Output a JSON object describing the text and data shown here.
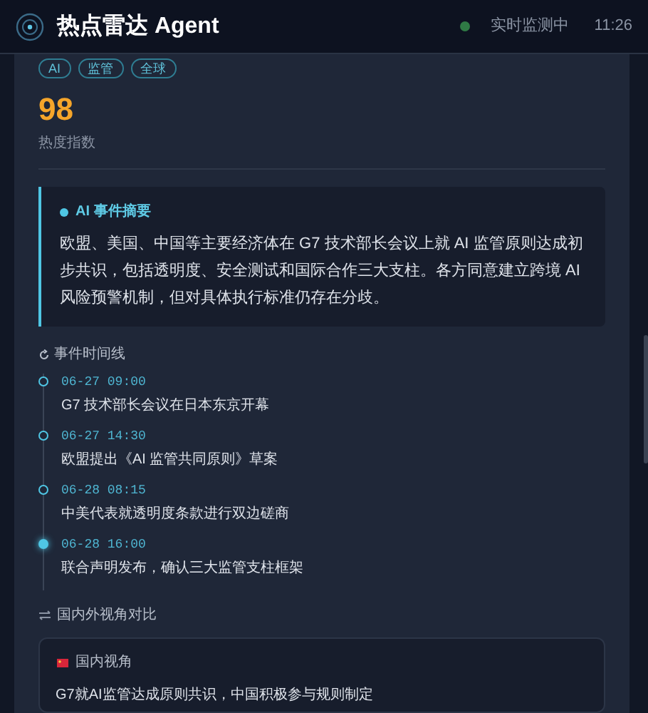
{
  "header": {
    "title": "热点雷达 Agent",
    "status": {
      "label": "实时监测中",
      "live": true
    },
    "time": "11:26"
  },
  "tags": [
    "AI",
    "监管",
    "全球"
  ],
  "score": {
    "value": "98",
    "label": "热度指数"
  },
  "summary": {
    "title": "AI 事件摘要",
    "text": "欧盟、美国、中国等主要经济体在 G7 技术部长会议上就 AI 监管原则达成初步共识，包括透明度、安全测试和国际合作三大支柱。各方同意建立跨境 AI 风险预警机制，但对具体执行标准仍存在分歧。"
  },
  "timeline": {
    "title": "事件时间线",
    "events": [
      {
        "time": "06-27 09:00",
        "text": "G7 技术部长会议在日本东京开幕",
        "current": false
      },
      {
        "time": "06-27 14:30",
        "text": "欧盟提出《AI 监管共同原则》草案",
        "current": false
      },
      {
        "time": "06-28 08:15",
        "text": "中美代表就透明度条款进行双边磋商",
        "current": false
      },
      {
        "time": "06-28 16:00",
        "text": "联合声明发布，确认三大监管支柱框架",
        "current": true
      }
    ]
  },
  "comparison": {
    "title": "国内外视角对比",
    "perspectives": [
      {
        "label": "国内视角",
        "headline": "G7就AI监管达成原则共识，中国积极参与规则制定"
      }
    ]
  }
}
